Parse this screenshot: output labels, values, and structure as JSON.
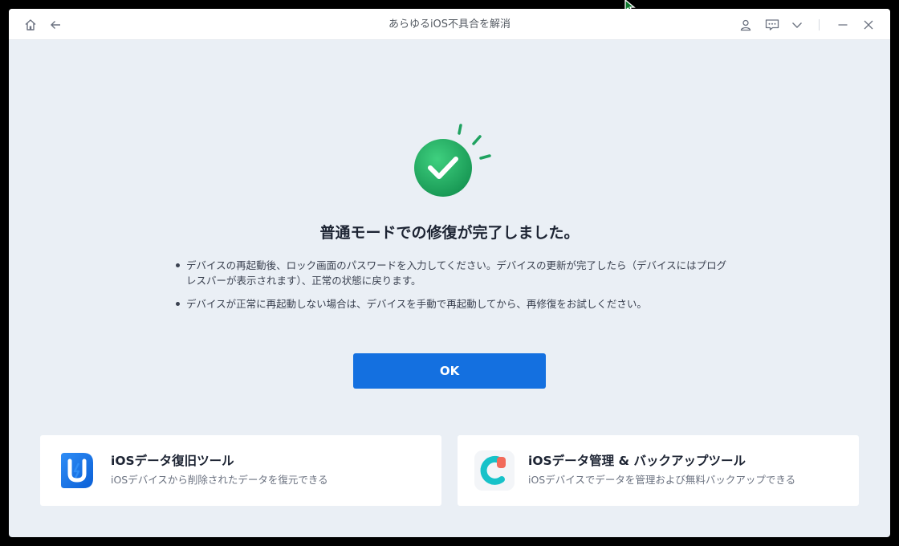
{
  "window": {
    "title": "あらゆるiOS不具合を解消",
    "toolbar_left": [
      "home-icon",
      "back-arrow-icon"
    ],
    "toolbar_right": [
      "user-icon",
      "feedback-icon",
      "chevron-down-icon",
      "minimize-icon",
      "close-icon"
    ]
  },
  "result": {
    "icon": "success-check-icon",
    "accent": "#1fa260",
    "heading": "普通モードでの修復が完了しました。",
    "notes": [
      "デバイスの再起動後、ロック画面のパスワードを入力してください。デバイスの更新が完了したら（デバイスにはプログレスバーが表示されます）、正常の状態に戻ります。",
      "デバイスが正常に再起動しない場合は、デバイスを手動で再起動してから、再修復をお試しください。"
    ],
    "ok_label": "OK",
    "button_color": "#1470e0"
  },
  "promos": [
    {
      "icon": "ultdata-logo-icon",
      "title": "iOSデータ復旧ツール",
      "subtitle": "iOSデバイスから削除されたデータを復元できる"
    },
    {
      "icon": "icarefone-logo-icon",
      "title": "iOSデータ管理 & バックアップツール",
      "subtitle": "iOSデバイスでデータを管理および無料バックアップできる"
    }
  ]
}
